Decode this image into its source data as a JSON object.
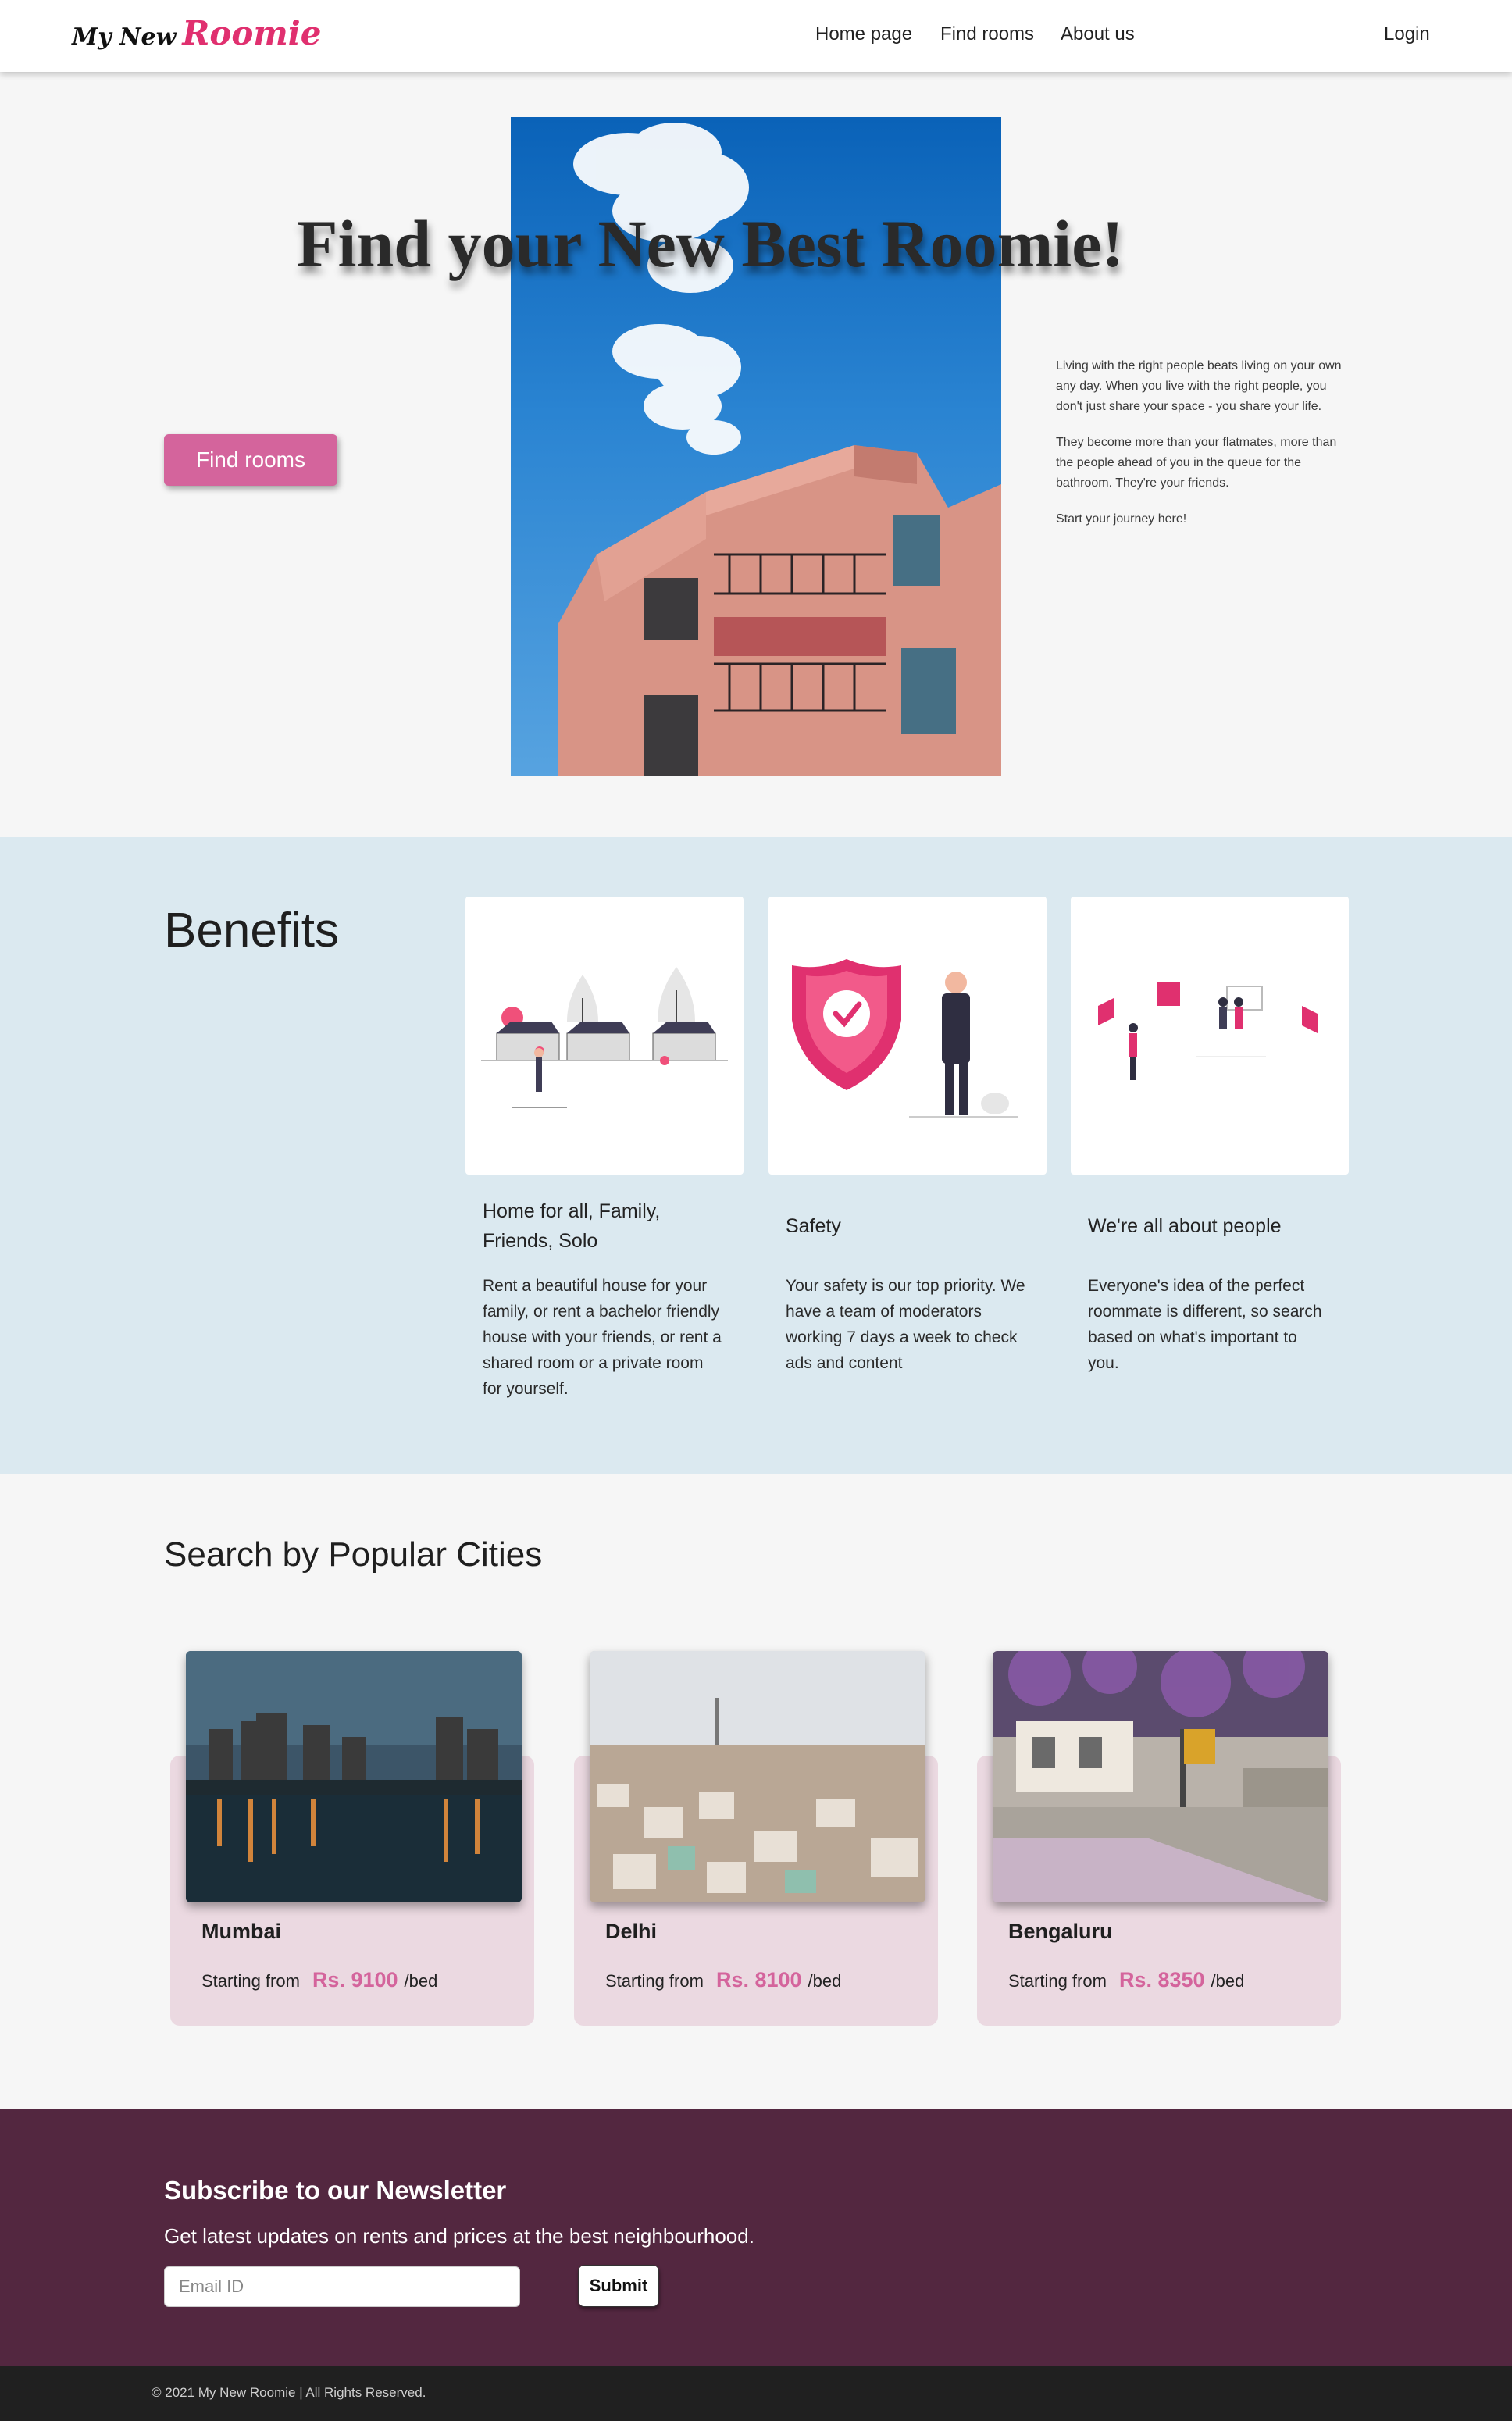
{
  "brand": {
    "logo_my_new": "My New",
    "logo_roomie": "Roomie"
  },
  "nav": {
    "home": "Home page",
    "find_rooms": "Find rooms",
    "about": "About us",
    "login": "Login"
  },
  "hero": {
    "title": "Find your New Best Roomie!",
    "button": "Find rooms",
    "paragraphs": [
      "Living with the right people beats living on your own any day. When you live with the right people, you don't just share your space - you share your life.",
      "They become more than your flatmates, more than the people ahead of you in the queue for the bathroom. They're your friends.",
      "Start your journey here!"
    ]
  },
  "benefits": {
    "title": "Benefits",
    "cards": [
      {
        "title": "Home for all, Family, Friends, Solo",
        "text": "Rent a beautiful house for your family, or rent a bachelor friendly house with your friends, or rent a shared room or a private room for yourself."
      },
      {
        "title": "Safety",
        "text": "Your safety is our top priority. We have a team of moderators working 7 days a week to check ads and content"
      },
      {
        "title": "We're all about people",
        "text": "Everyone's idea of the perfect roommate is different, so search based on what's important to you."
      }
    ]
  },
  "cities": {
    "title": "Search by Popular Cities",
    "items": [
      {
        "name": "Mumbai",
        "starting_from": "Starting from",
        "price": "Rs. 9100",
        "unit": "/bed"
      },
      {
        "name": "Delhi",
        "starting_from": "Starting from",
        "price": "Rs. 8100",
        "unit": "/bed"
      },
      {
        "name": "Bengaluru",
        "starting_from": "Starting from",
        "price": "Rs. 8350",
        "unit": "/bed"
      }
    ]
  },
  "newsletter": {
    "title": "Subscribe to our Newsletter",
    "subtitle": "Get latest updates on rents and prices at the best neighbourhood.",
    "email_placeholder": "Email ID",
    "submit": "Submit"
  },
  "footer": {
    "copyright": "© 2021 My New Roomie | All Rights Reserved."
  },
  "colors": {
    "accent": "#d4649c",
    "brand_pink": "#e0306f",
    "benefits_bg": "#dbe9f0",
    "newsletter_bg": "#532740",
    "card_bg": "#ebd9e1",
    "footer_bg": "#202020"
  }
}
